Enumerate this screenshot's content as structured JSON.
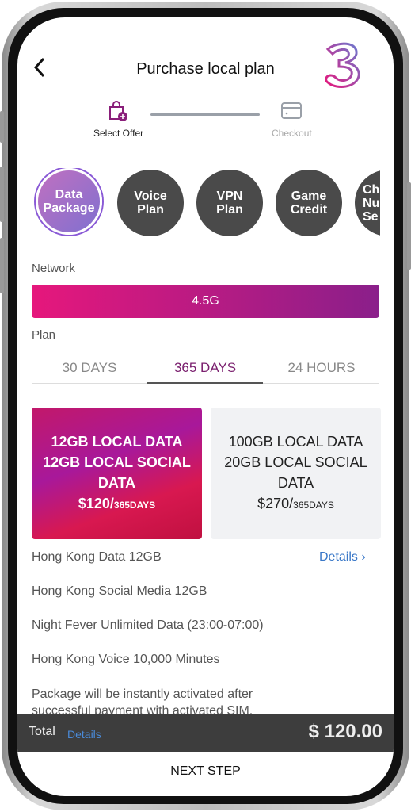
{
  "header": {
    "title": "Purchase local plan",
    "back_icon": "chevron-left-icon",
    "logo": "3"
  },
  "steps": [
    {
      "label": "Select Offer",
      "icon": "bag-plus-icon",
      "active": true
    },
    {
      "label": "Checkout",
      "icon": "card-icon",
      "active": false
    }
  ],
  "categories": [
    {
      "line1": "Data",
      "line2": "Package",
      "active": true
    },
    {
      "line1": "Voice",
      "line2": "Plan"
    },
    {
      "line1": "VPN",
      "line2": "Plan"
    },
    {
      "line1": "Game",
      "line2": "Credit"
    },
    {
      "line1": "Ch",
      "line2": "Nu",
      "line3": "Se"
    }
  ],
  "network": {
    "label": "Network",
    "value": "4.5G"
  },
  "plan": {
    "label": "Plan",
    "tabs": [
      "30 DAYS",
      "365 DAYS",
      "24 HOURS"
    ],
    "selected": "365 DAYS"
  },
  "offers": [
    {
      "line1": "12GB LOCAL DATA",
      "line2": "12GB LOCAL SOCIAL",
      "line3": "DATA",
      "price": "$120/",
      "period": "365DAYS",
      "selected": true
    },
    {
      "line1": "100GB LOCAL DATA",
      "line2": "20GB LOCAL SOCIAL",
      "line3": "DATA",
      "price": "$270/",
      "period": "365DAYS",
      "selected": false
    }
  ],
  "features": [
    "Hong Kong Data 12GB",
    "Hong Kong Social Media 12GB",
    "Night Fever Unlimited Data (23:00-07:00)",
    "Hong Kong Voice 10,000 Minutes",
    "Package will be instantly activated after successful payment with activated SIM."
  ],
  "details_label": "Details ›",
  "footer": {
    "total_label": "Total",
    "details_label": "Details",
    "total": "$ 120.00",
    "next": "NEXT STEP"
  },
  "colors": {
    "accent": "#7a1f6e",
    "link": "#3a78c8",
    "network_start": "#e6177c",
    "network_end": "#8a1f8a"
  }
}
